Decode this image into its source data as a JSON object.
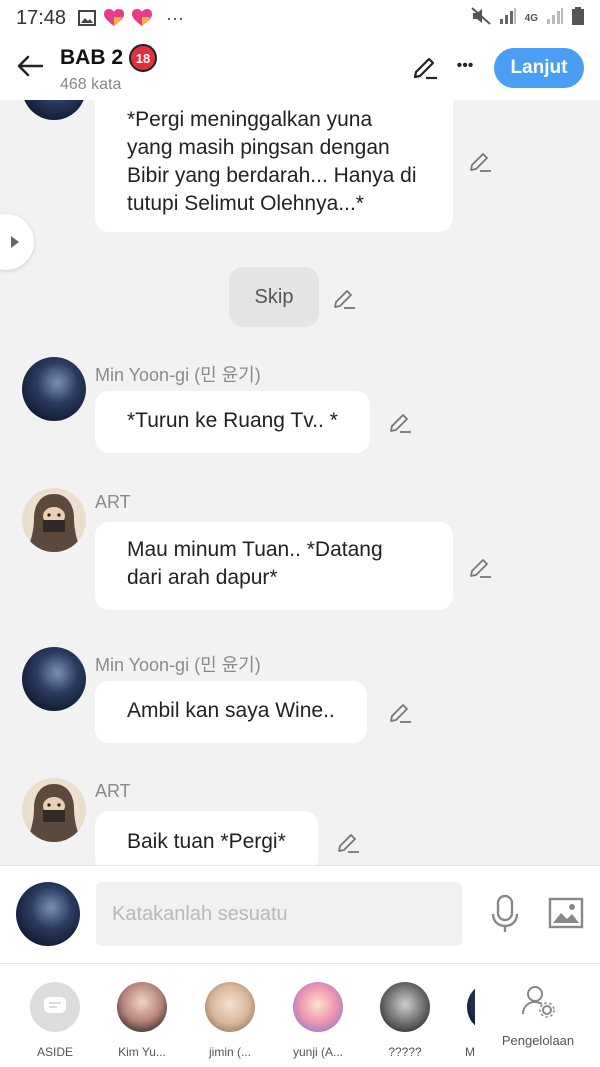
{
  "status_bar": {
    "time": "17:48",
    "more_dots": "···",
    "network": "4G"
  },
  "header": {
    "title": "BAB 2",
    "age_badge": "18",
    "word_count": "468 kata",
    "next_label": "Lanjut",
    "more_label": "•••",
    "accent_color": "#4a9ef5"
  },
  "messages": [
    {
      "speaker": "",
      "text": "*Pergi meninggalkan yuna yang masih pingsan dengan Bibir yang berdarah... Hanya di tutupi Selimut Olehnya...*"
    },
    {
      "speaker": "Min Yoon-gi (민 윤기)",
      "text": "*Turun ke Ruang Tv.. *"
    },
    {
      "speaker": "ART",
      "text": "Mau minum Tuan.. *Datang dari arah dapur*"
    },
    {
      "speaker": "Min Yoon-gi (민 윤기)",
      "text": "Ambil kan saya Wine.."
    },
    {
      "speaker": "ART",
      "text": "Baik tuan *Pergi*"
    }
  ],
  "skip_label": "Skip",
  "input": {
    "placeholder": "Katakanlah sesuatu"
  },
  "characters": [
    {
      "label": "ASIDE",
      "icon": "chat-bubble-icon"
    },
    {
      "label": "Kim Yu..."
    },
    {
      "label": "jimin (..."
    },
    {
      "label": "yunji (A..."
    },
    {
      "label": "?????"
    },
    {
      "label": "M"
    }
  ],
  "manage_label": "Pengelolaan"
}
